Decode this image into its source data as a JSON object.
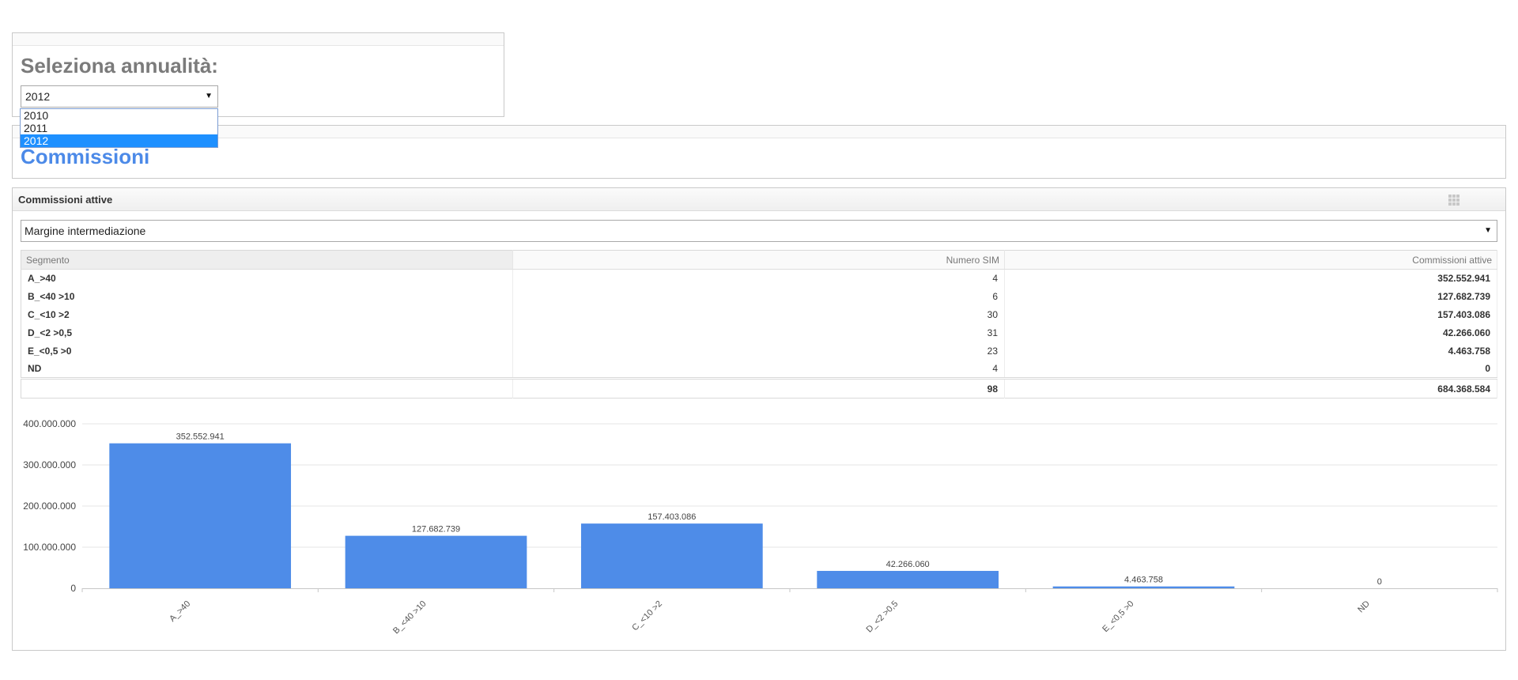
{
  "year_panel": {
    "title": "Seleziona annualità:",
    "selected": "2012",
    "options": [
      "2010",
      "2011",
      "2012"
    ],
    "highlighted": "2012"
  },
  "section": {
    "title": "Commissioni"
  },
  "widget": {
    "title": "Commissioni attive",
    "measure_selected": "Margine intermediazione"
  },
  "table": {
    "columns": [
      "Segmento",
      "Numero SIM",
      "Commissioni attive"
    ],
    "rows": [
      {
        "segment": "A_>40",
        "num_sim": "4",
        "commissioni": "352.552.941"
      },
      {
        "segment": "B_<40 >10",
        "num_sim": "6",
        "commissioni": "127.682.739"
      },
      {
        "segment": "C_<10 >2",
        "num_sim": "30",
        "commissioni": "157.403.086"
      },
      {
        "segment": "D_<2 >0,5",
        "num_sim": "31",
        "commissioni": "42.266.060"
      },
      {
        "segment": "E_<0,5 >0",
        "num_sim": "23",
        "commissioni": "4.463.758"
      },
      {
        "segment": "ND",
        "num_sim": "4",
        "commissioni": "0"
      }
    ],
    "total": {
      "segment": "",
      "num_sim": "98",
      "commissioni": "684.368.584"
    }
  },
  "chart_data": {
    "type": "bar",
    "categories": [
      "A_>40",
      "B_<40 >10",
      "C_<10 >2",
      "D_<2 >0,5",
      "E_<0,5 >0",
      "ND"
    ],
    "values": [
      352552941,
      127682739,
      157403086,
      42266060,
      4463758,
      0
    ],
    "data_labels": [
      "352.552.941",
      "127.682.739",
      "157.403.086",
      "42.266.060",
      "4.463.758",
      "0"
    ],
    "y_ticks": [
      0,
      100000000,
      200000000,
      300000000,
      400000000
    ],
    "y_tick_labels": [
      "0",
      "100.000.000",
      "200.000.000",
      "300.000.000",
      "400.000.000"
    ],
    "ylim": [
      0,
      400000000
    ],
    "grid": true,
    "bar_color": "#4e8ce8",
    "title": "",
    "xlabel": "",
    "ylabel": ""
  }
}
